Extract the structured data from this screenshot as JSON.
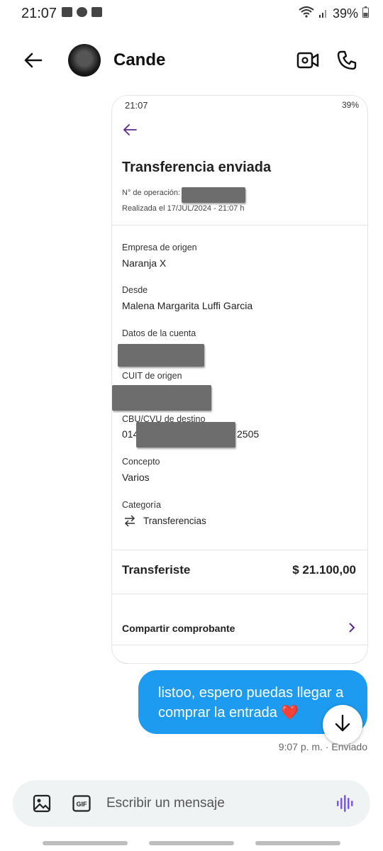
{
  "status_bar": {
    "time": "21:07",
    "battery": "39%"
  },
  "header": {
    "contact_name": "Cande"
  },
  "attached_screenshot": {
    "status_time": "21:07",
    "status_battery": "39%",
    "title": "Transferencia enviada",
    "operation_label": "N° de operación:",
    "date_text": "Realizada el 17/JUL/2024 - 21:07 h",
    "fields": [
      {
        "label": "Empresa de origen",
        "value": "Naranja X"
      },
      {
        "label": "Desde",
        "value": "Malena Margarita Luffi Garcia"
      },
      {
        "label": "Datos de la cuenta",
        "value": ""
      },
      {
        "label": "CUIT de origen",
        "value": ""
      },
      {
        "label": "CBU/CVU de destino",
        "value_prefix": "014",
        "value_suffix": "2505"
      },
      {
        "label": "Concepto",
        "value": "Varios"
      },
      {
        "label": "Categoría",
        "value": "Transferencias"
      }
    ],
    "transfer_label": "Transferiste",
    "transfer_amount": "$ 21.100,00",
    "share_label": "Compartir comprobante"
  },
  "message": {
    "text": "listoo, espero puedas llegar a comprar la entrada ❤️",
    "meta": "9:07 p. m. · Enviado"
  },
  "composer": {
    "placeholder": "Escribir un mensaje"
  },
  "colors": {
    "bubble": "#1d9bf0",
    "accent_purple": "#5b2a86",
    "voice_purple": "#7856ff"
  },
  "icons": [
    "back-arrow-icon",
    "video-call-icon",
    "phone-icon",
    "image-icon",
    "gif-icon",
    "voice-icon",
    "arrow-down-icon",
    "chevron-right-icon",
    "transfer-arrows-icon"
  ]
}
